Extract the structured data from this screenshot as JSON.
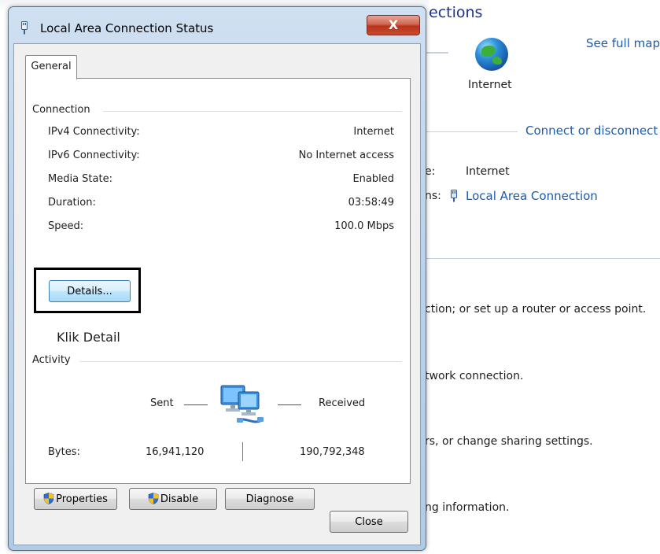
{
  "background": {
    "heading_fragment": "ections",
    "see_full_map": "See full map",
    "internet_label": "Internet",
    "connect_or_disconnect": "Connect or disconnect",
    "access_type_fragment": "e:",
    "access_type_value": "Internet",
    "connections_fragment": "ns:",
    "connection_link": "Local Area Connection",
    "task1": "ction; or set up a router or access point.",
    "task2": "twork connection.",
    "task3": "rs, or change sharing settings.",
    "task4": "ng information."
  },
  "dialog": {
    "title": "Local Area Connection Status",
    "close_x": "X",
    "tab_general": "General",
    "connection": {
      "heading": "Connection",
      "rows": [
        {
          "label": "IPv4 Connectivity:",
          "value": "Internet"
        },
        {
          "label": "IPv6 Connectivity:",
          "value": "No Internet access"
        },
        {
          "label": "Media State:",
          "value": "Enabled"
        },
        {
          "label": "Duration:",
          "value": "03:58:49"
        },
        {
          "label": "Speed:",
          "value": "100.0 Mbps"
        }
      ],
      "details_button": "Details...",
      "annotation": "Klik Detail"
    },
    "activity": {
      "heading": "Activity",
      "sent": "Sent",
      "received": "Received",
      "bytes_label": "Bytes:",
      "bytes_sent": "16,941,120",
      "bytes_received": "190,792,348"
    },
    "buttons": {
      "properties": "Properties",
      "disable": "Disable",
      "diagnose": "Diagnose",
      "close": "Close"
    }
  },
  "colors": {
    "link": "#1e5aa8",
    "heading_blue": "#1e3287",
    "close_red": "#c94a2c"
  }
}
